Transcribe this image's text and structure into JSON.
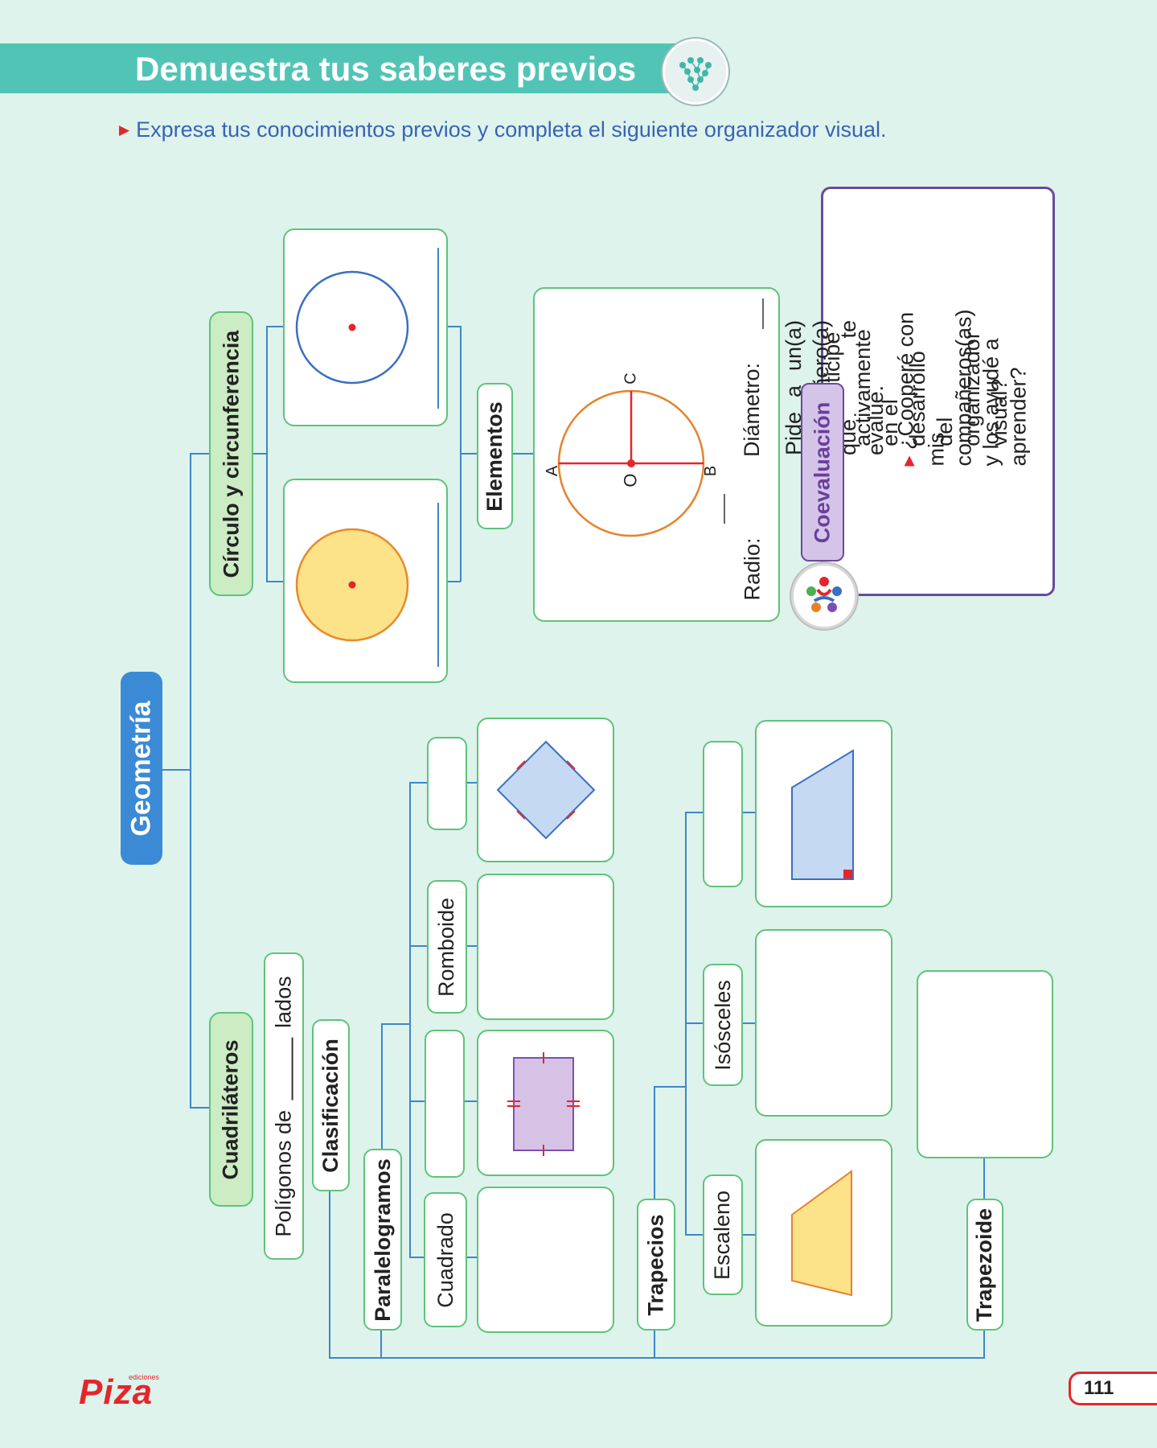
{
  "header": {
    "title": "Demuestra tus saberes previos",
    "icon": "network-icon"
  },
  "instruction": "Expresa tus conocimientos previos y completa el siguiente organizador visual.",
  "organizer": {
    "root": "Geometría",
    "circle_branch": {
      "title": "Círculo y circunferencia",
      "elements_label": "Elementos",
      "points": {
        "a": "A",
        "o": "O",
        "b": "B",
        "c": "C"
      },
      "radius_label": "Radio:",
      "diameter_label": "Diámetro:"
    },
    "quad_branch": {
      "title": "Cuadriláteros",
      "definition_prefix": "Polígonos de",
      "definition_suffix": "lados",
      "classification": "Clasificación",
      "paralelogramos": "Paralelogramos",
      "cuadrado": "Cuadrado",
      "romboide": "Romboide",
      "trapecios": "Trapecios",
      "escaleno": "Escaleno",
      "isosceles": "Isósceles",
      "trapezoide": "Trapezoide"
    },
    "colors": {
      "circle_fill": "#fce288",
      "circle_stroke": "#e78a2c",
      "blue": "#3b6fc0",
      "rhombus_fill": "#c5d9f2",
      "rect_fill": "#d5c2e5",
      "red": "#e4262b",
      "orange": "#e6822c"
    }
  },
  "coevaluation": {
    "title": "Coevaluación",
    "icon": "team-icon",
    "intro": "Pide a un(a) compañero(a) que te evalúe.",
    "items": [
      "¿Participé activamente en el desarrollo del organizador visual?",
      "¿Cooperé con mis compañeros(as) y los ayudé a aprender?"
    ]
  },
  "footer": {
    "publisher": "Piza",
    "publisher_small": "ediciones",
    "page": "111"
  }
}
